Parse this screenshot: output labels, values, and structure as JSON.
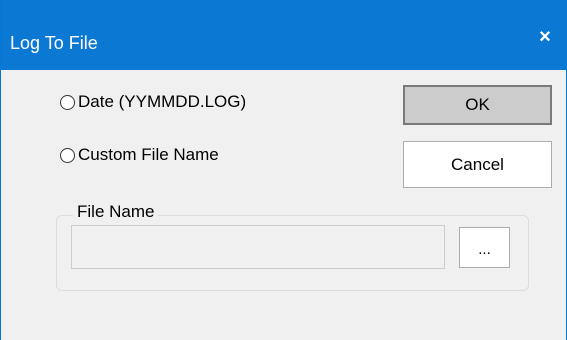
{
  "window": {
    "title": "Log To File",
    "close_glyph": "×"
  },
  "options": {
    "date_label": "Date (YYMMDD.LOG)",
    "custom_label": "Custom File Name"
  },
  "buttons": {
    "ok_label": "OK",
    "cancel_label": "Cancel",
    "browse_label": "..."
  },
  "file_name_group": {
    "legend": "File Name",
    "value": ""
  },
  "colors": {
    "titlebar": "#0b78d4",
    "background": "#f0f0f0"
  }
}
